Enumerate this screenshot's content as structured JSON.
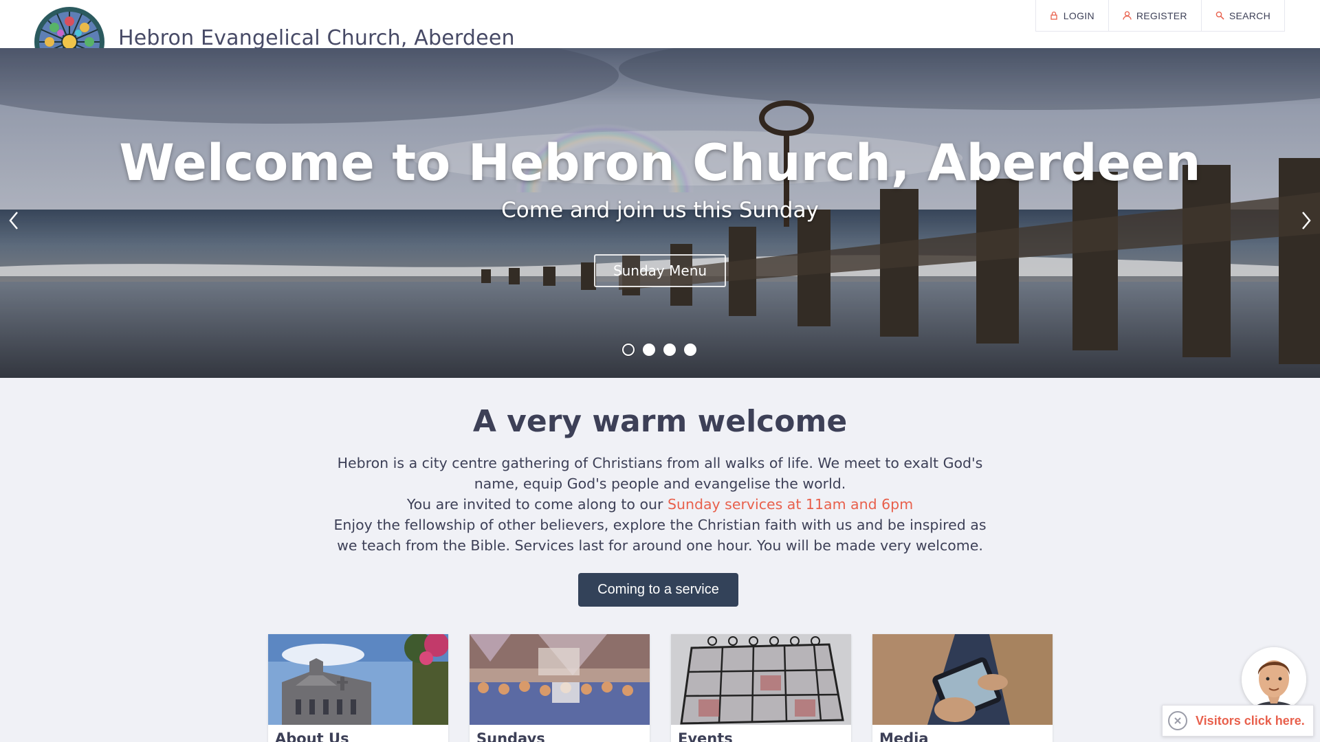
{
  "header": {
    "site_title": "Hebron Evangelical Church, Aberdeen",
    "login_label": "LOGIN",
    "register_label": "REGISTER",
    "search_label": "SEARCH"
  },
  "hero": {
    "title": "Welcome to Hebron Church, Aberdeen",
    "subtitle": "Come and join us this Sunday",
    "button_label": "Sunday Menu",
    "slide_count": 4,
    "active_slide": 1
  },
  "welcome": {
    "title": "A very warm welcome",
    "paragraph_1": "Hebron is a city centre gathering of Christians from all walks of life. We meet to exalt God's name, equip God's people and evangelise the world.",
    "paragraph_2_prefix": "You are invited to come along to our ",
    "paragraph_2_link": "Sunday services at 11am and 6pm",
    "paragraph_3": "Enjoy the fellowship of other believers, explore the Christian faith with us and be inspired as we teach from the Bible. Services last for around one hour. You will be made very welcome.",
    "cta_label": "Coming to a service"
  },
  "cards": [
    {
      "title": "About Us"
    },
    {
      "title": "Sundays"
    },
    {
      "title": "Events"
    },
    {
      "title": "Media"
    }
  ],
  "visitor_widget": {
    "label": "Visitors click here."
  },
  "colors": {
    "accent": "#e8604c",
    "primary_button": "#334259",
    "text": "#3d4057",
    "background": "#f0f1f6"
  }
}
